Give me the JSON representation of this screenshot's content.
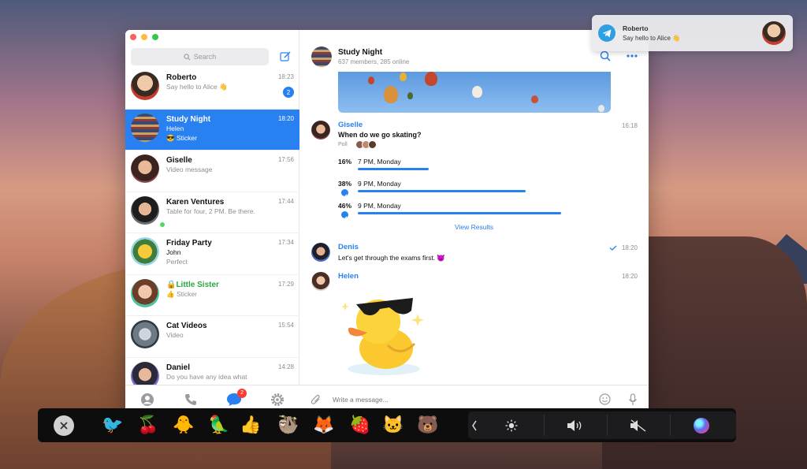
{
  "window": {
    "title": "Telegram"
  },
  "search": {
    "placeholder": "Search"
  },
  "chats": [
    {
      "name": "Roberto",
      "preview": "Say hello to Alice 👋",
      "time": "18:23",
      "badge": "2"
    },
    {
      "name": "Study Night",
      "author": "Helen",
      "preview": "😎 Sticker",
      "time": "18:20"
    },
    {
      "name": "Giselle",
      "preview": "Video message",
      "time": "17:56"
    },
    {
      "name": "Karen Ventures",
      "preview": "Table for four, 2 PM. Be there.",
      "time": "17:44"
    },
    {
      "name": "Friday Party",
      "author": "John",
      "preview": "Perfect",
      "time": "17:34"
    },
    {
      "name": "Little Sister",
      "preview": "👍 Sticker",
      "time": "17:29"
    },
    {
      "name": "Cat Videos",
      "preview": "Video",
      "time": "15:54"
    },
    {
      "name": "Daniel",
      "preview": "Do you have any idea what",
      "time": "14:28"
    }
  ],
  "tabs": {
    "chats_badge": "2"
  },
  "conversation": {
    "title": "Study Night",
    "subtitle": "637 members, 285 online",
    "poll": {
      "sender": "Giselle",
      "time": "16:18",
      "question": "When do we go skating?",
      "type_label": "Poll",
      "options": [
        {
          "percent": "16%",
          "label": "7 PM, Monday",
          "share": 0.16,
          "voted": false
        },
        {
          "percent": "38%",
          "label": "9 PM, Monday",
          "share": 0.38,
          "voted": true
        },
        {
          "percent": "46%",
          "label": "9 PM, Monday",
          "share": 0.46,
          "voted": true
        }
      ],
      "view_results": "View Results"
    },
    "message_denis": {
      "sender": "Denis",
      "text": "Let's get through the exams first. 😈",
      "time": "18:20"
    },
    "message_helen": {
      "sender": "Helen",
      "time": "18:20"
    },
    "composer_placeholder": "Write a message..."
  },
  "notification": {
    "title": "Roberto",
    "body": "Say hello to Alice 👋"
  },
  "touchbar": {
    "stickers": [
      "🐦",
      "🍒",
      "🐥",
      "🦜",
      "👍",
      "🦥",
      "🦊",
      "🍓",
      "🐱",
      "🐻"
    ]
  }
}
